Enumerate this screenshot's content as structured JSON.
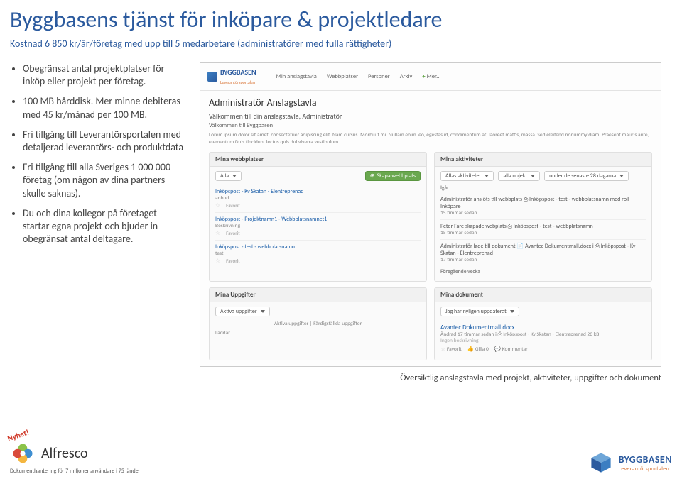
{
  "title": "Byggbasens tjänst för inköpare & projektledare",
  "subtitle": "Kostnad 6 850 kr/år/företag med upp till 5 medarbetare (administratörer med fulla rättigheter)",
  "bullets": [
    "Obegränsat antal projektplatser för inköp eller projekt per företag.",
    "100 MB hårddisk. Mer minne debiteras med 45 kr/månad per 100 MB.",
    "Fri tillgång till Leverantörsportalen med detaljerad leverantörs- och produktdata",
    "Fri tillgång till alla Sveriges 1 000 000 företag (om någon av dina partners skulle saknas).",
    "Du och dina kollegor på företaget startar egna projekt och bjuder in obegränsat antal deltagare."
  ],
  "screenshot": {
    "brand": "BYGGBASEN",
    "brand_sub": "Leverantörsportalen",
    "nav": [
      "Min anslagstavla",
      "Webbplatser",
      "Personer",
      "Arkiv",
      "Mer..."
    ],
    "page_title": "Administratör Anslagstavla",
    "welcome": "Välkommen till din anslagstavla, Administratör",
    "welcome_sub": "Välkommen till Byggbasen",
    "lorem": "Lorem ipsum dolor sit amet, consectetuer adipiscing elit. Nam cursus. Morbi ut mi. Nullam enim leo, egestas id, condimentum at, laoreet mattis, massa. Sed eleifend nonummy diam. Praesent mauris ante, elementum Duis tincidunt lectus quis dui viverra vestibulum.",
    "panels": {
      "webbplatser": {
        "title": "Mina webbplatser",
        "filter": "Alla",
        "create": "Skapa webbplats",
        "items": [
          {
            "title": "Inköpspost - Kv Skatan - Elentreprenad",
            "sub": "anbud",
            "fav": "Favorit"
          },
          {
            "title": "Inköpspost - Projektnamn1 - Webbplatsnamnet1",
            "sub": "Beskrivning",
            "fav": "Favorit"
          },
          {
            "title": "Inköpspost - test - webbplatsnamn",
            "sub": "test",
            "fav": "Favorit"
          }
        ]
      },
      "aktiviteter": {
        "title": "Mina aktiviteter",
        "filters": [
          "Allas aktiviteter",
          "alla objekt",
          "under de senaste 28 dagarna"
        ],
        "groups": {
          "igar": "Igår",
          "items1": [
            {
              "text": "Administratör anslöts till webbplats ⎙ Inköpspost - test - webbplatsnamn med roll Inköpare",
              "time": "15 timmar sedan"
            },
            {
              "text": "Peter Fare skapade webplats ⎙ Inköpspost - test - webbplatsnamn",
              "time": "15 timmar sedan"
            },
            {
              "text": "Administratör lade till dokument 📄 Avantec Dokumentmall.docx i ⎙ Inköpspost - Kv Skatan - Elentreprenad",
              "time": "17 timmar sedan"
            }
          ],
          "prev": "Föregående vecka"
        }
      },
      "uppgifter": {
        "title": "Mina Uppgifter",
        "filter": "Aktiva uppgifter",
        "tabs": [
          "Aktiva uppgifter",
          "Färdigställda uppgifter"
        ],
        "loading": "Laddar..."
      },
      "dokument": {
        "title": "Mina dokument",
        "tab": "Jag har nyligen uppdaterat",
        "doc": {
          "name": "Avantec Dokumentmall.docx",
          "meta": "Ändrad 17 timmar sedan i ⎙ Inköpspost - Kv Skatan - Elentreprenad   20 kB",
          "desc": "Ingen beskrivning",
          "actions": [
            "Favorit",
            "Gilla 0",
            "Kommentar"
          ]
        }
      }
    }
  },
  "caption": "Översiktlig anslagstavla med projekt, aktiviteter, uppgifter och dokument",
  "footer": {
    "nyhet": "Nyhet!",
    "alfresco_name": "Alfresco",
    "alfresco_sub": "Dokumenthantering för 7 miljoner användare i 75 länder",
    "bb_name": "BYGGBASEN",
    "bb_sub": "Leverantörsportalen"
  }
}
